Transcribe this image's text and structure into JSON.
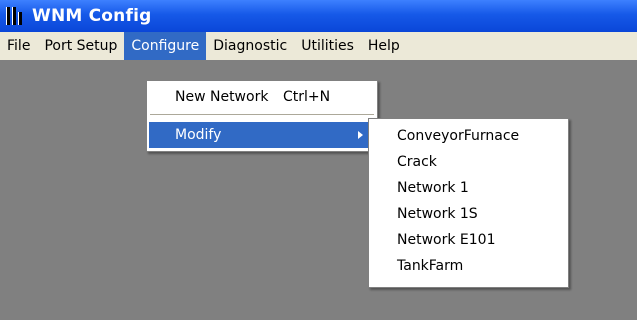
{
  "window": {
    "title": "WNM Config",
    "icon": "wnm-app-icon"
  },
  "menubar": {
    "items": [
      {
        "label": "File"
      },
      {
        "label": "Port Setup"
      },
      {
        "label": "Configure",
        "active": true
      },
      {
        "label": "Diagnostic"
      },
      {
        "label": "Utilities"
      },
      {
        "label": "Help"
      }
    ]
  },
  "configure_menu": {
    "new_network": {
      "label": "New Network",
      "shortcut": "Ctrl+N"
    },
    "modify": {
      "label": "Modify",
      "icon": "submenu-arrow-icon"
    }
  },
  "modify_submenu": {
    "items": [
      {
        "label": "ConveyorFurnace"
      },
      {
        "label": "Crack"
      },
      {
        "label": "Network 1"
      },
      {
        "label": "Network 1S"
      },
      {
        "label": "Network E101"
      },
      {
        "label": "TankFarm"
      }
    ]
  },
  "colors": {
    "titlebar": "#0a46d8",
    "menubar": "#ece9d8",
    "highlight": "#316ac5",
    "client_bg": "#808080"
  }
}
